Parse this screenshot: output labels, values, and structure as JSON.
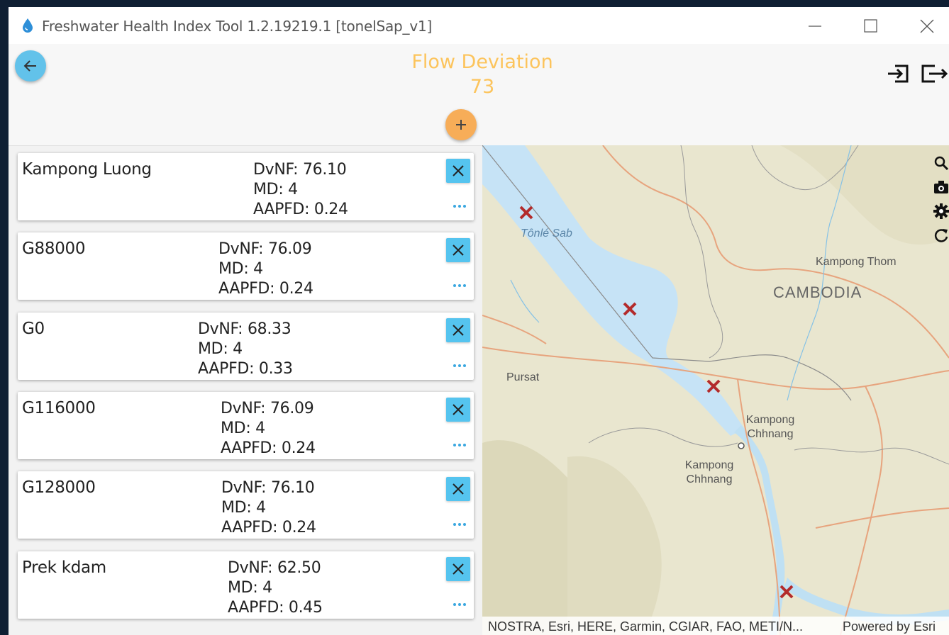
{
  "window": {
    "title": "Freshwater Health Index Tool 1.2.19219.1 [tonelSap_v1]",
    "controls": [
      "minimize",
      "maximize",
      "close"
    ]
  },
  "header": {
    "title": "Flow Deviation",
    "value": "73",
    "title_color": "#fcc45c",
    "icons": [
      "back-arrow-icon",
      "plus-icon",
      "import-icon",
      "export-icon"
    ]
  },
  "stations": [
    {
      "name": "Kampong Luong",
      "dvnf": "DvNF: 76.10",
      "md": "MD: 4",
      "aapfd": "AAPFD: 0.24"
    },
    {
      "name": "G88000",
      "dvnf": "DvNF: 76.09",
      "md": "MD: 4",
      "aapfd": "AAPFD: 0.24"
    },
    {
      "name": "G0",
      "dvnf": "DvNF: 68.33",
      "md": "MD: 4",
      "aapfd": "AAPFD: 0.33"
    },
    {
      "name": "G116000",
      "dvnf": "DvNF: 76.09",
      "md": "MD: 4",
      "aapfd": "AAPFD: 0.24"
    },
    {
      "name": "G128000",
      "dvnf": "DvNF: 76.10",
      "md": "MD: 4",
      "aapfd": "AAPFD: 0.24"
    },
    {
      "name": "Prek kdam",
      "dvnf": "DvNF: 62.50",
      "md": "MD: 4",
      "aapfd": "AAPFD: 0.45"
    }
  ],
  "map": {
    "labels": {
      "tonle_sab": "Tônlé Sab",
      "kampong_thom": "Kampong Thom",
      "cambodia": "CAMBODIA",
      "pursat": "Pursat",
      "kampong_chhnang_1": "Kampong Chhnang",
      "kampong_chhnang_2": "Kampong Chhnang"
    },
    "tools": [
      "search-icon",
      "camera-icon",
      "gear-icon",
      "refresh-icon"
    ],
    "attribution": "NOSTRA, Esri, HERE, Garmin, CGIAR, FAO, METI/N...",
    "powered_by": "Powered by Esri",
    "colors": {
      "water": "#c6e3f6",
      "land": "#e9e6cf",
      "roads": "#e7a47e",
      "marker": "#b32b2b"
    }
  },
  "colors": {
    "accent_blue": "#55c4ef",
    "accent_orange": "#f7ad58"
  }
}
